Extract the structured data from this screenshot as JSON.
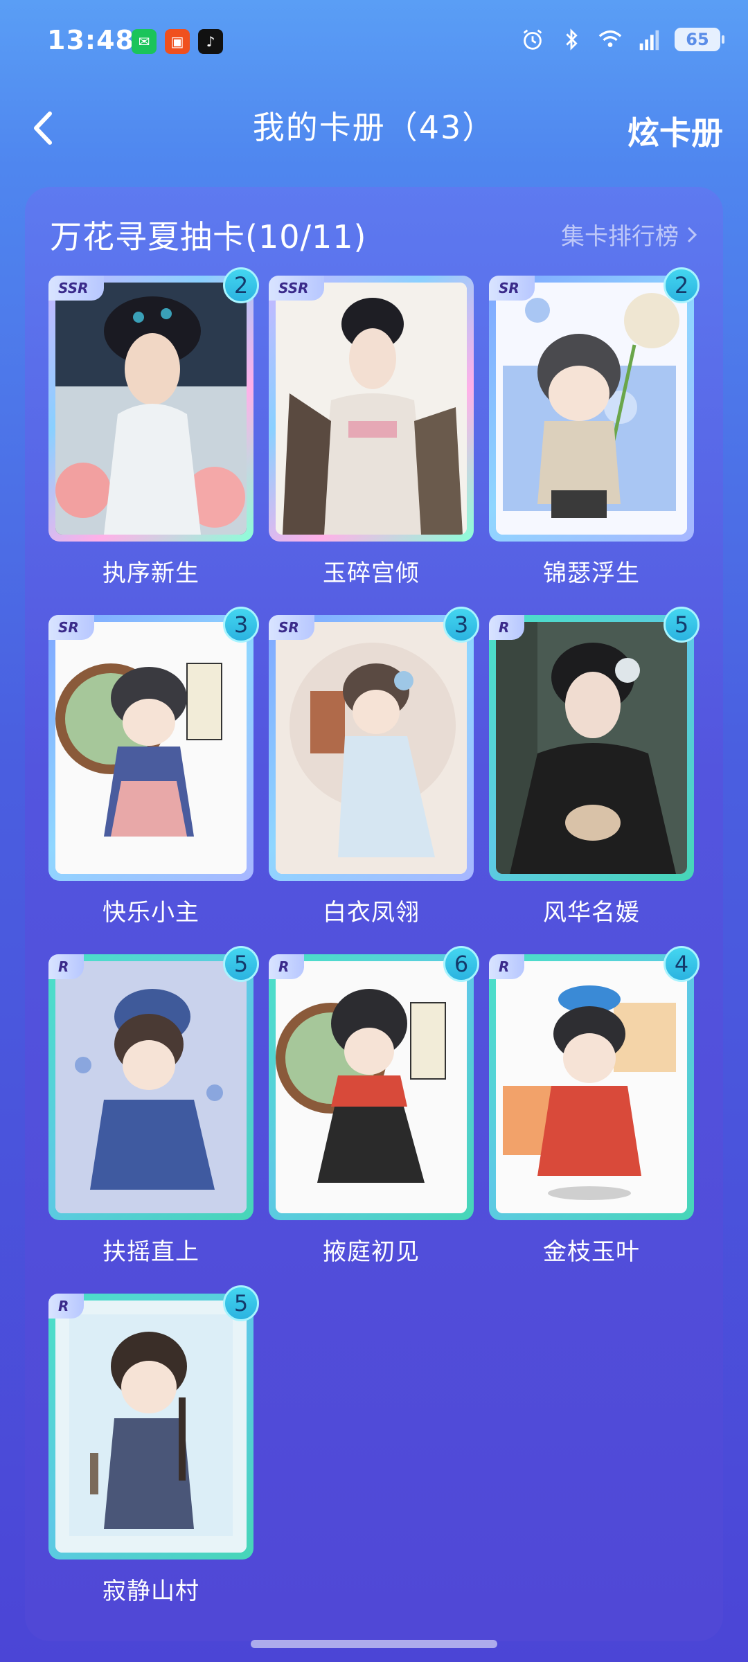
{
  "status": {
    "time": "13:48",
    "battery": "65",
    "apps": [
      "wechat-icon",
      "video-app-icon",
      "tiktok-icon"
    ]
  },
  "header": {
    "title": "我的卡册（43）",
    "share_label": "炫卡册"
  },
  "album": {
    "title": "万花寻夏抽卡(10/11)",
    "rank_label": "集卡排行榜",
    "cards": [
      {
        "name": "执序新生",
        "rarity": "SSR",
        "count": "2"
      },
      {
        "name": "玉碎宫倾",
        "rarity": "SSR",
        "count": ""
      },
      {
        "name": "锦瑟浮生",
        "rarity": "SR",
        "count": "2"
      },
      {
        "name": "快乐小主",
        "rarity": "SR",
        "count": "3"
      },
      {
        "name": "白衣凤翎",
        "rarity": "SR",
        "count": "3"
      },
      {
        "name": "风华名媛",
        "rarity": "R",
        "count": "5"
      },
      {
        "name": "扶摇直上",
        "rarity": "R",
        "count": "5"
      },
      {
        "name": "掖庭初见",
        "rarity": "R",
        "count": "6"
      },
      {
        "name": "金枝玉叶",
        "rarity": "R",
        "count": "4"
      },
      {
        "name": "寂静山村",
        "rarity": "R",
        "count": "5"
      }
    ]
  }
}
